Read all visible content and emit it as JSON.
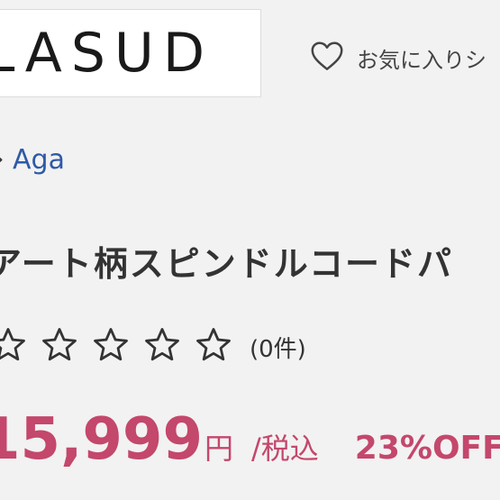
{
  "header": {
    "logo_text": "LASUD",
    "favorite_label": "お気に入りシ"
  },
  "breadcrumb": {
    "separator": "›",
    "current": "Aga"
  },
  "product": {
    "title": "アート柄スピンドルコードパ",
    "rating": {
      "value": 0,
      "max": 5,
      "count_text": "(0件)"
    },
    "price": {
      "amount": "15,999",
      "unit": "円",
      "tax_label": "/税込",
      "discount_text": "23%OFF"
    }
  },
  "colors": {
    "price": "#c4476c",
    "link": "#2e5aa8",
    "text": "#333333",
    "background": "#f2f2f2"
  },
  "icons": [
    "heart-icon",
    "chevron-right-icon",
    "star-outline-icon"
  ]
}
